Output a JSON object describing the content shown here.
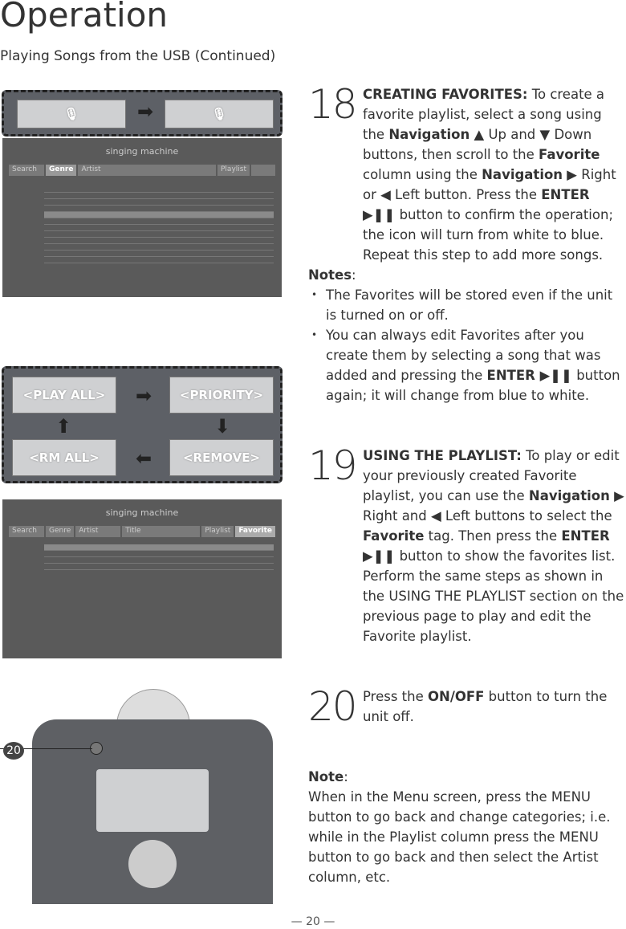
{
  "header": {
    "title": "Operation",
    "subtitle": "Playing Songs from the USB (Continued)"
  },
  "step18": {
    "num": "18",
    "heading": "CREATING FAVORITES:",
    "t1": " To create a favorite playlist, select a song using the ",
    "nav": "Navigation",
    "t2": " ▲ Up and ▼ Down buttons, then scroll to the ",
    "fav": "Favorite",
    "t3": " column using the ",
    "nav2": "Navigation",
    "t4": " ▶ Right or ◀ Left button. Press the ",
    "enter": "ENTER ▶❚❚",
    "t5": " button to confirm the operation; the icon will turn from white to blue. Repeat this step to add more songs."
  },
  "notes18": {
    "label": "Notes",
    "items": [
      "The Favorites will be stored even if the unit is turned on or off."
    ],
    "i2a": "You can always edit Favorites after you create them by selecting a song that was added and pressing the ",
    "i2b": "ENTER ▶❚❚",
    "i2c": " button again; it will change from blue to white."
  },
  "step19": {
    "num": "19",
    "heading": "USING THE PLAYLIST:",
    "t1": " To play or edit your previously created Favorite playlist, you can use the ",
    "nav": "Navigation",
    "t2": " ▶ Right and ◀ Left buttons to select the ",
    "fav": "Favorite",
    "t3": " tag. Then press the ",
    "enter": "ENTER ▶❚❚",
    "t4": " button to show the favorites list. Perform the same steps as shown in the USING THE PLAYLIST section on the previous page to play and edit the Favorite playlist."
  },
  "step20": {
    "num": "20",
    "t1": "Press the ",
    "btn": "ON/OFF",
    "t2": " button to turn the unit off."
  },
  "note": {
    "label": "Note",
    "text": "When in the Menu screen, press the MENU button to go back and change categories; i.e. while in the Playlist column press the MENU button to go back and then select the Artist column, etc."
  },
  "screen": {
    "brand": "singing machine",
    "search": "Search",
    "genre": "Genre",
    "artist": "Artist",
    "title": "Title",
    "playlist": "Playlist",
    "favorite": "Favorite"
  },
  "callout2": {
    "play_all": "<PLAY ALL>",
    "priority": "<PRIORITY>",
    "rm_all": "<RM ALL>",
    "remove": "<REMOVE>"
  },
  "device": {
    "callout": "20"
  },
  "page": {
    "number": "— 20 —"
  }
}
